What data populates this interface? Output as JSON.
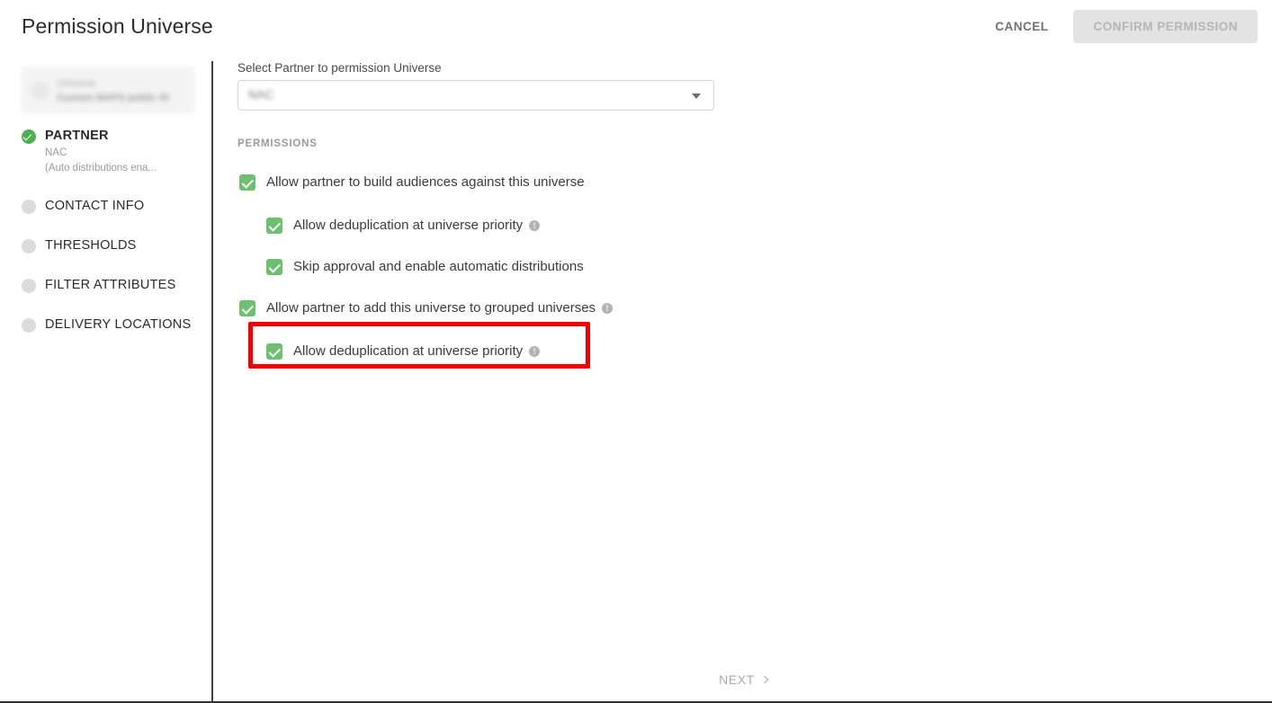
{
  "header": {
    "title": "Permission Universe",
    "cancel_label": "CANCEL",
    "confirm_label": "CONFIRM PERMISSION"
  },
  "sidebar": {
    "entity_card": {
      "icon": "target-icon",
      "line1": "Universe",
      "line2": "Custom MAPS public ID",
      "redacted": true
    },
    "steps": [
      {
        "label": "PARTNER",
        "state": "done",
        "marker": "check-circle-icon",
        "sub1": "NAC",
        "sub2": "(Auto distributions ena..."
      },
      {
        "label": "CONTACT INFO",
        "state": "pending",
        "marker": "circle-icon"
      },
      {
        "label": "THRESHOLDS",
        "state": "pending",
        "marker": "circle-icon"
      },
      {
        "label": "FILTER ATTRIBUTES",
        "state": "pending",
        "marker": "circle-icon"
      },
      {
        "label": "DELIVERY LOCATIONS",
        "state": "pending",
        "marker": "circle-icon"
      }
    ]
  },
  "main": {
    "partner_field_label": "Select Partner to permission Universe",
    "partner_select_value": "NAC",
    "partner_select_caret": "chevron-down-icon",
    "permissions_title": "PERMISSIONS",
    "permissions": [
      {
        "label": "Allow partner to build audiences against this universe",
        "checked": true,
        "indent": 0,
        "info": false
      },
      {
        "label": "Allow deduplication at universe priority",
        "checked": true,
        "indent": 1,
        "info": true,
        "info_glyph": "!"
      },
      {
        "label": "Skip approval and enable automatic distributions",
        "checked": true,
        "indent": 1,
        "info": false
      },
      {
        "label": "Allow partner to add this universe to grouped universes",
        "checked": true,
        "indent": 0,
        "info": true,
        "info_glyph": "!"
      },
      {
        "label": "Allow deduplication at universe priority",
        "checked": true,
        "indent": 1,
        "info": true,
        "info_glyph": "!",
        "highlighted": true
      }
    ],
    "next_label": "NEXT",
    "next_icon": "chevron-right-icon"
  },
  "colors": {
    "accent_green": "#6ec071",
    "step_done_green": "#4caf50",
    "highlight_red": "#f50000",
    "disabled_button_bg": "#e3e3e3",
    "divider_dark": "#3d4145"
  }
}
